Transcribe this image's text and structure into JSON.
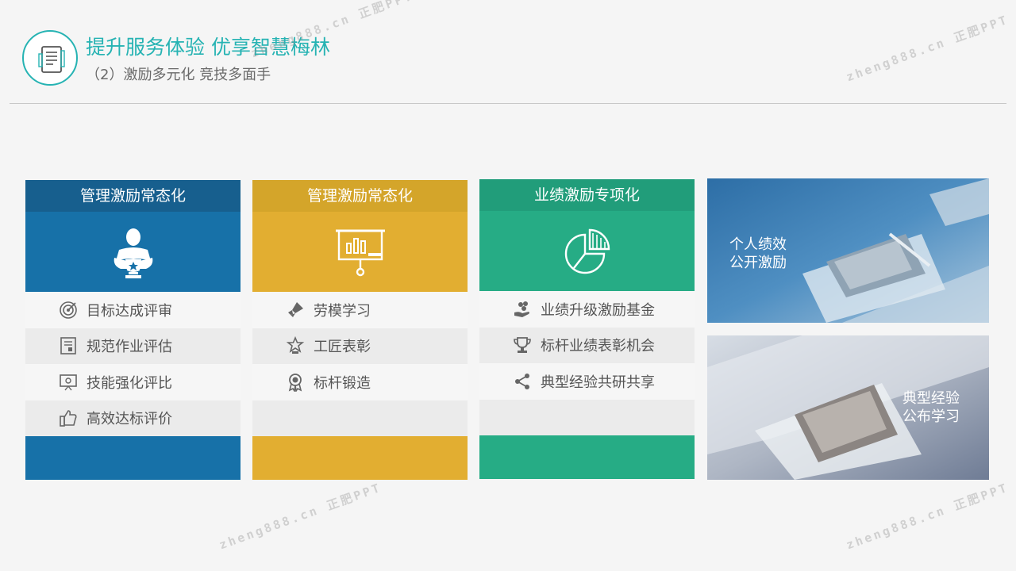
{
  "header": {
    "title": "提升服务体验  优享智慧梅林",
    "subtitle": "（2）激励多元化 竞技多面手"
  },
  "colors": {
    "teal": "#26b3b3",
    "blue": "#1771a8",
    "yellow": "#e2ae31",
    "green": "#26ac85"
  },
  "cards": [
    {
      "title": "管理激励常态化",
      "hero_icon": "trophy-person-icon",
      "items": [
        {
          "label": "目标达成评审",
          "icon": "target-icon"
        },
        {
          "label": "规范作业评估",
          "icon": "document-icon"
        },
        {
          "label": "技能强化评比",
          "icon": "presentation-icon"
        },
        {
          "label": "高效达标评价",
          "icon": "thumbs-up-icon"
        }
      ]
    },
    {
      "title": "管理激励常态化",
      "hero_icon": "presentation-chart-icon",
      "items": [
        {
          "label": "劳模学习",
          "icon": "rocket-icon"
        },
        {
          "label": "工匠表彰",
          "icon": "star-badge-icon"
        },
        {
          "label": "标杆锻造",
          "icon": "medal-icon"
        }
      ]
    },
    {
      "title": "业绩激励专项化",
      "hero_icon": "pie-chart-icon",
      "items": [
        {
          "label": "业绩升级激励基金",
          "icon": "coins-hand-icon"
        },
        {
          "label": "标杆业绩表彰机会",
          "icon": "trophy-icon"
        },
        {
          "label": "典型经验共研共享",
          "icon": "share-icon"
        }
      ]
    }
  ],
  "photos": [
    {
      "line1": "个人绩效",
      "line2": "公开激励"
    },
    {
      "line1": "典型经验",
      "line2": "公布学习"
    }
  ],
  "watermark": {
    "site": "zheng888.cn",
    "brand": "正肥PPT"
  }
}
